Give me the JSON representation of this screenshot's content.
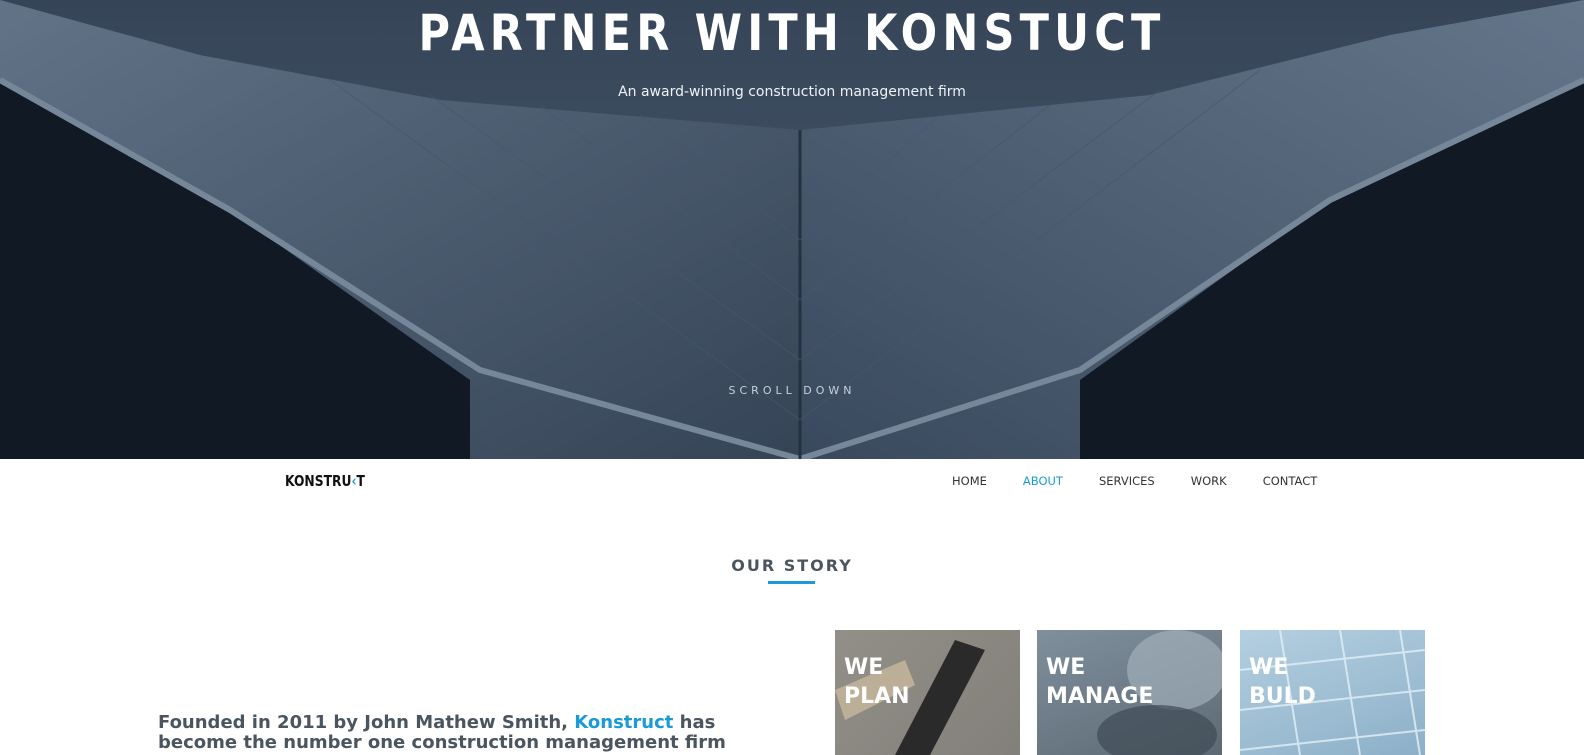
{
  "hero": {
    "title": "PARTNER WITH KONSTUCT",
    "subtitle": "An award-winning construction management firm",
    "scroll_label": "SCROLL DOWN"
  },
  "nav": {
    "logo_text_main": "KONSTRU",
    "logo_text_accent": "‹",
    "logo_text_end": "T",
    "items": [
      {
        "label": "HOME",
        "active": false
      },
      {
        "label": "ABOUT",
        "active": true
      },
      {
        "label": "SERVICES",
        "active": false
      },
      {
        "label": "WORK",
        "active": false
      },
      {
        "label": "CONTACT",
        "active": false
      }
    ]
  },
  "section": {
    "title": "OUR STORY",
    "story_prefix": "Founded in 2011 by John Mathew Smith, ",
    "story_brand": "Konstruct",
    "story_suffix": " has become the number one construction management firm"
  },
  "cards": [
    {
      "label": "WE\nPLAN"
    },
    {
      "label": "WE\nMANAGE"
    },
    {
      "label": "WE\nBULD"
    }
  ],
  "colors": {
    "accent": "#1a9ad6",
    "heading": "#4a5560"
  }
}
